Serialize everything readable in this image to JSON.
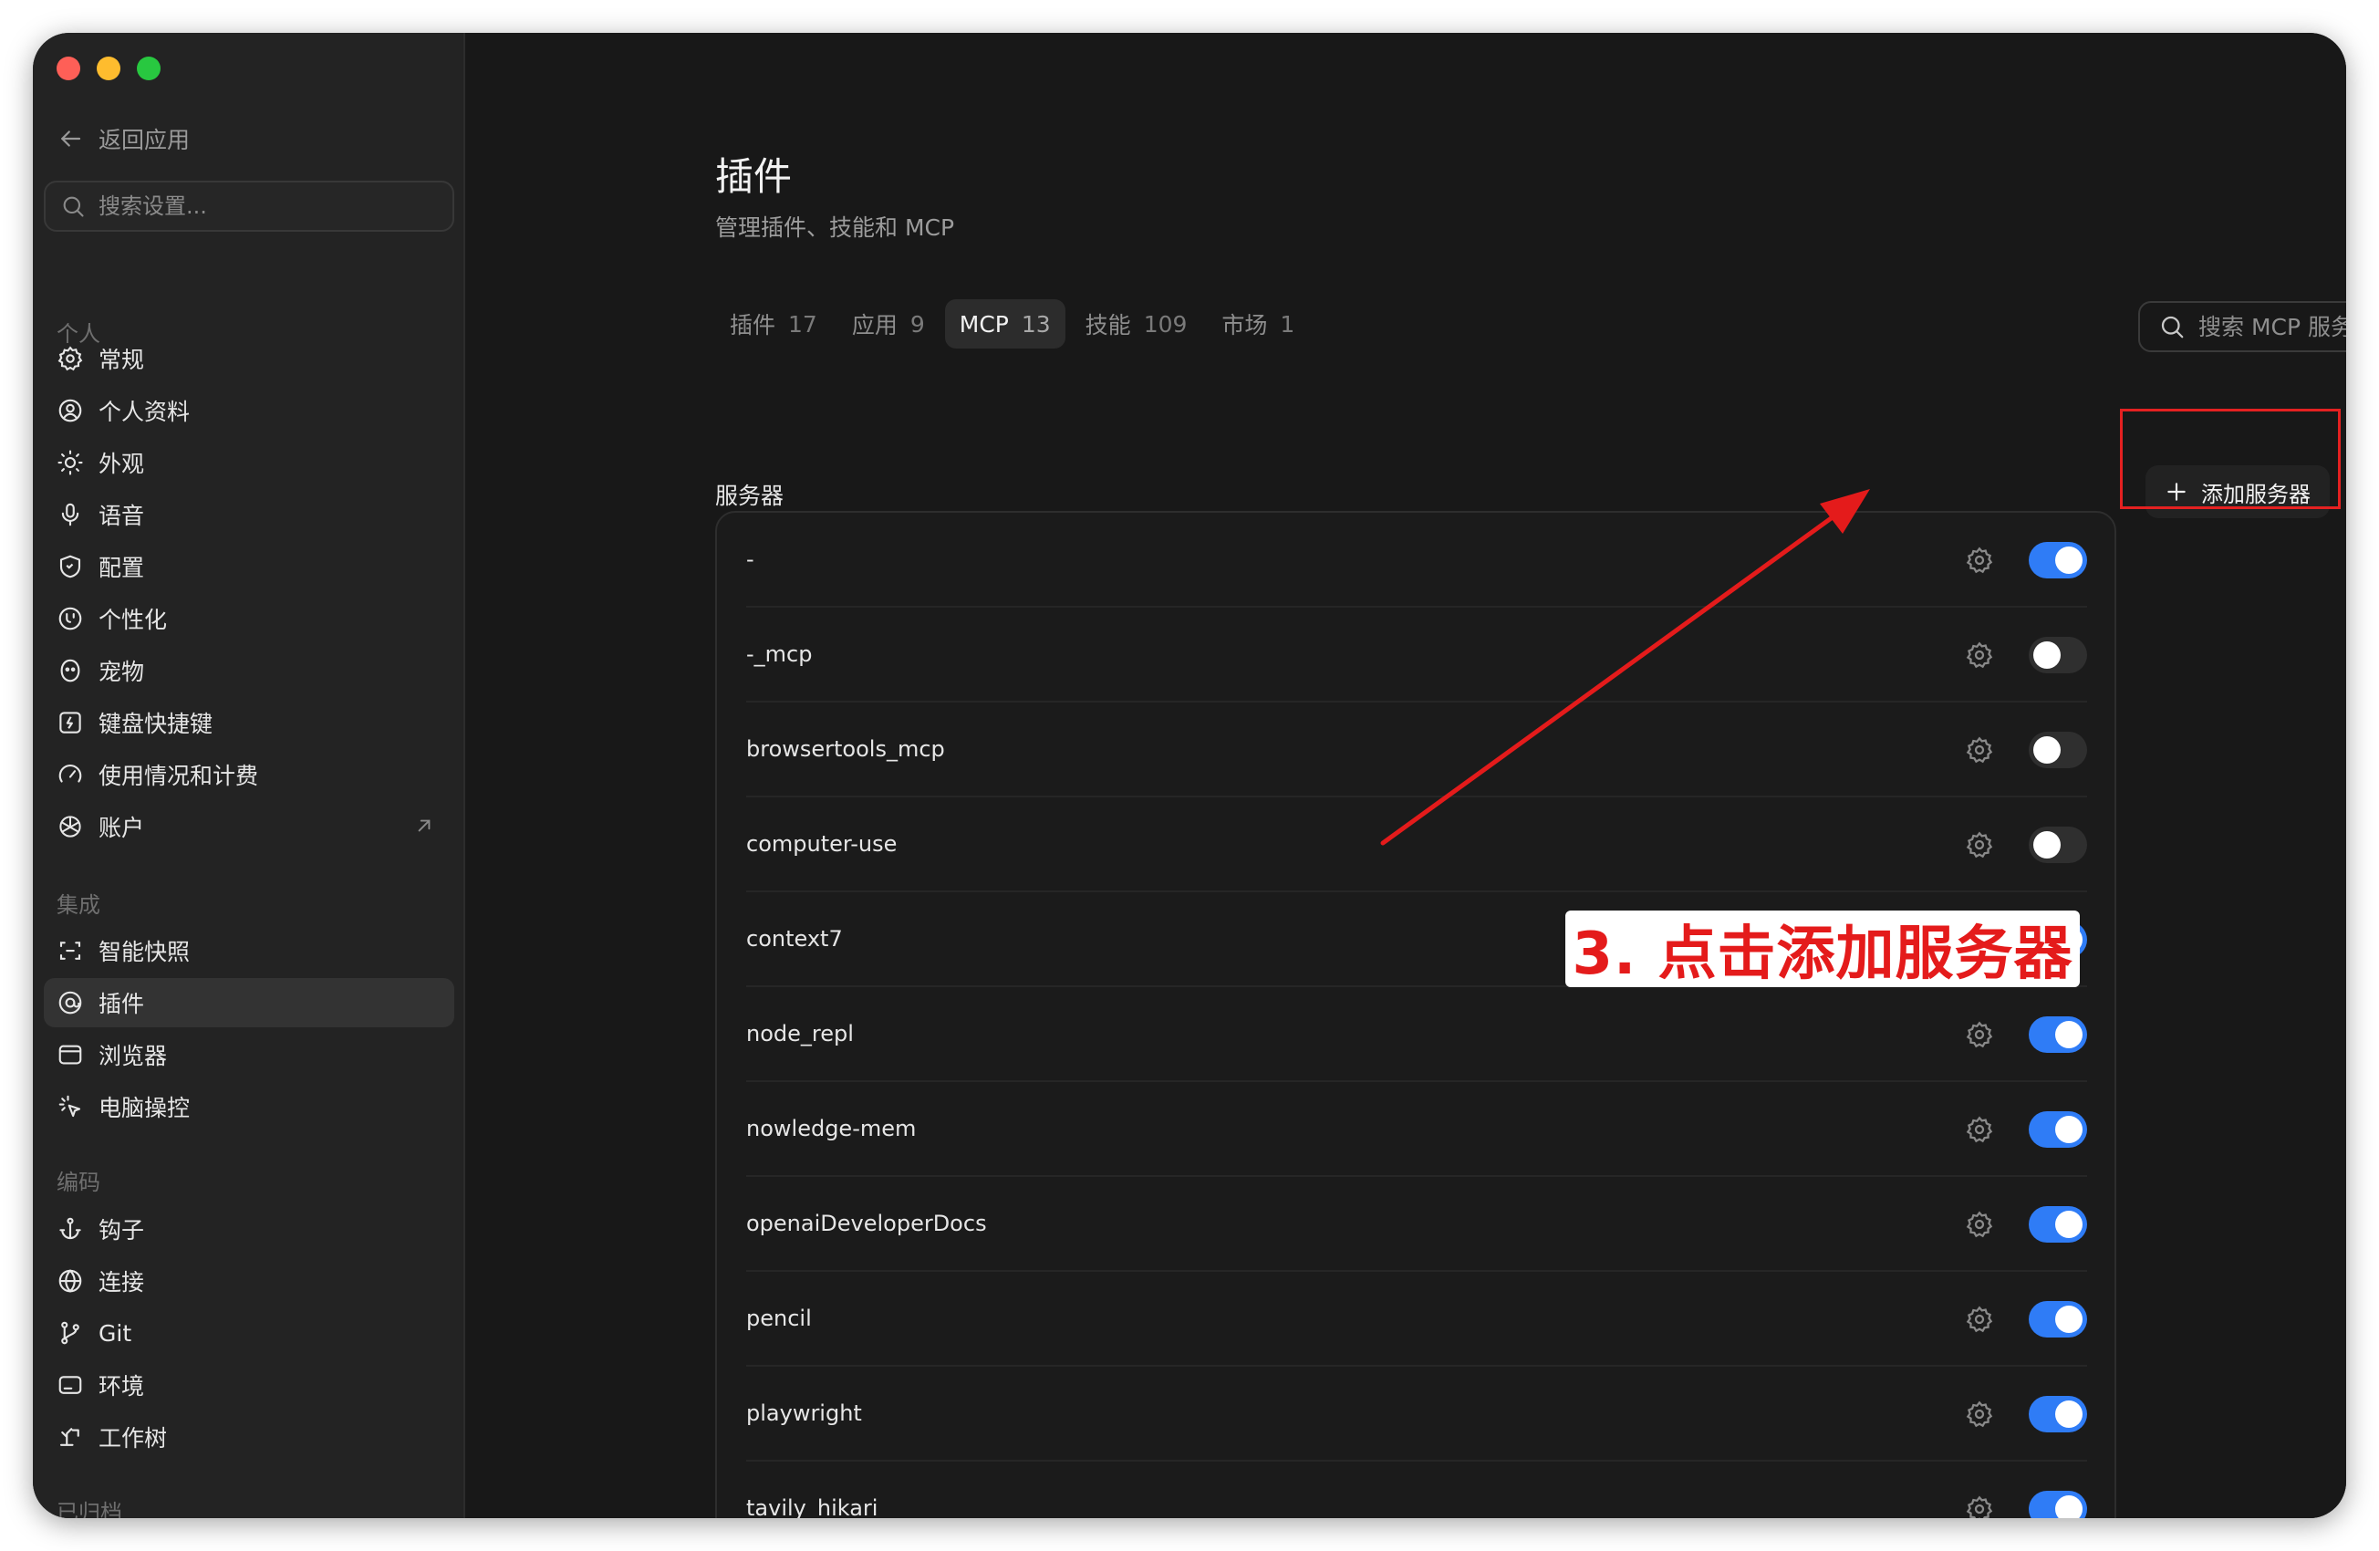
{
  "sidebar": {
    "back_label": "返回应用",
    "search_placeholder": "搜索设置...",
    "sections": {
      "personal": "个人",
      "integration": "集成",
      "coding": "编码",
      "archived": "已归档"
    },
    "items": [
      {
        "label": "常规",
        "icon": "gear-icon"
      },
      {
        "label": "个人资料",
        "icon": "profile-icon"
      },
      {
        "label": "外观",
        "icon": "sun-icon"
      },
      {
        "label": "语音",
        "icon": "microphone-icon"
      },
      {
        "label": "配置",
        "icon": "shield-icon"
      },
      {
        "label": "个性化",
        "icon": "personalize-icon"
      },
      {
        "label": "宠物",
        "icon": "pet-icon"
      },
      {
        "label": "键盘快捷键",
        "icon": "keyboard-icon"
      },
      {
        "label": "使用情况和计费",
        "icon": "gauge-icon"
      },
      {
        "label": "账户",
        "icon": "openai-icon"
      },
      {
        "label": "智能快照",
        "icon": "snapshot-icon"
      },
      {
        "label": "插件",
        "icon": "plugin-icon"
      },
      {
        "label": "浏览器",
        "icon": "browser-icon"
      },
      {
        "label": "电脑操控",
        "icon": "cursor-icon"
      },
      {
        "label": "钩子",
        "icon": "anchor-icon"
      },
      {
        "label": "连接",
        "icon": "globe-icon"
      },
      {
        "label": "Git",
        "icon": "git-branch-icon"
      },
      {
        "label": "环境",
        "icon": "terminal-icon"
      },
      {
        "label": "工作树",
        "icon": "worktree-icon"
      }
    ]
  },
  "main": {
    "title": "插件",
    "subtitle": "管理插件、技能和 MCP",
    "tabs": [
      {
        "label": "插件",
        "count": "17"
      },
      {
        "label": "应用",
        "count": "9"
      },
      {
        "label": "MCP",
        "count": "13"
      },
      {
        "label": "技能",
        "count": "109"
      },
      {
        "label": "市场",
        "count": "1"
      }
    ],
    "active_tab": "MCP",
    "search_placeholder": "搜索 MCP 服务器",
    "section_title": "服务器",
    "add_button": "添加服务器",
    "servers": [
      {
        "name": "-",
        "enabled": true
      },
      {
        "name": "-_mcp",
        "enabled": false
      },
      {
        "name": "browsertools_mcp",
        "enabled": false
      },
      {
        "name": "computer-use",
        "enabled": false
      },
      {
        "name": "context7",
        "enabled": true
      },
      {
        "name": "node_repl",
        "enabled": true
      },
      {
        "name": "nowledge-mem",
        "enabled": true
      },
      {
        "name": "openaiDeveloperDocs",
        "enabled": true
      },
      {
        "name": "pencil",
        "enabled": true
      },
      {
        "name": "playwright",
        "enabled": true
      },
      {
        "name": "tavily_hikari",
        "enabled": true
      }
    ]
  },
  "annotation": {
    "text": "3. 点击添加服务器",
    "color": "#e41b1b"
  },
  "colors": {
    "accent": "#2f7cf6",
    "traffic_red": "#fe5f57",
    "traffic_yellow": "#febc2e",
    "traffic_green": "#28c840"
  }
}
